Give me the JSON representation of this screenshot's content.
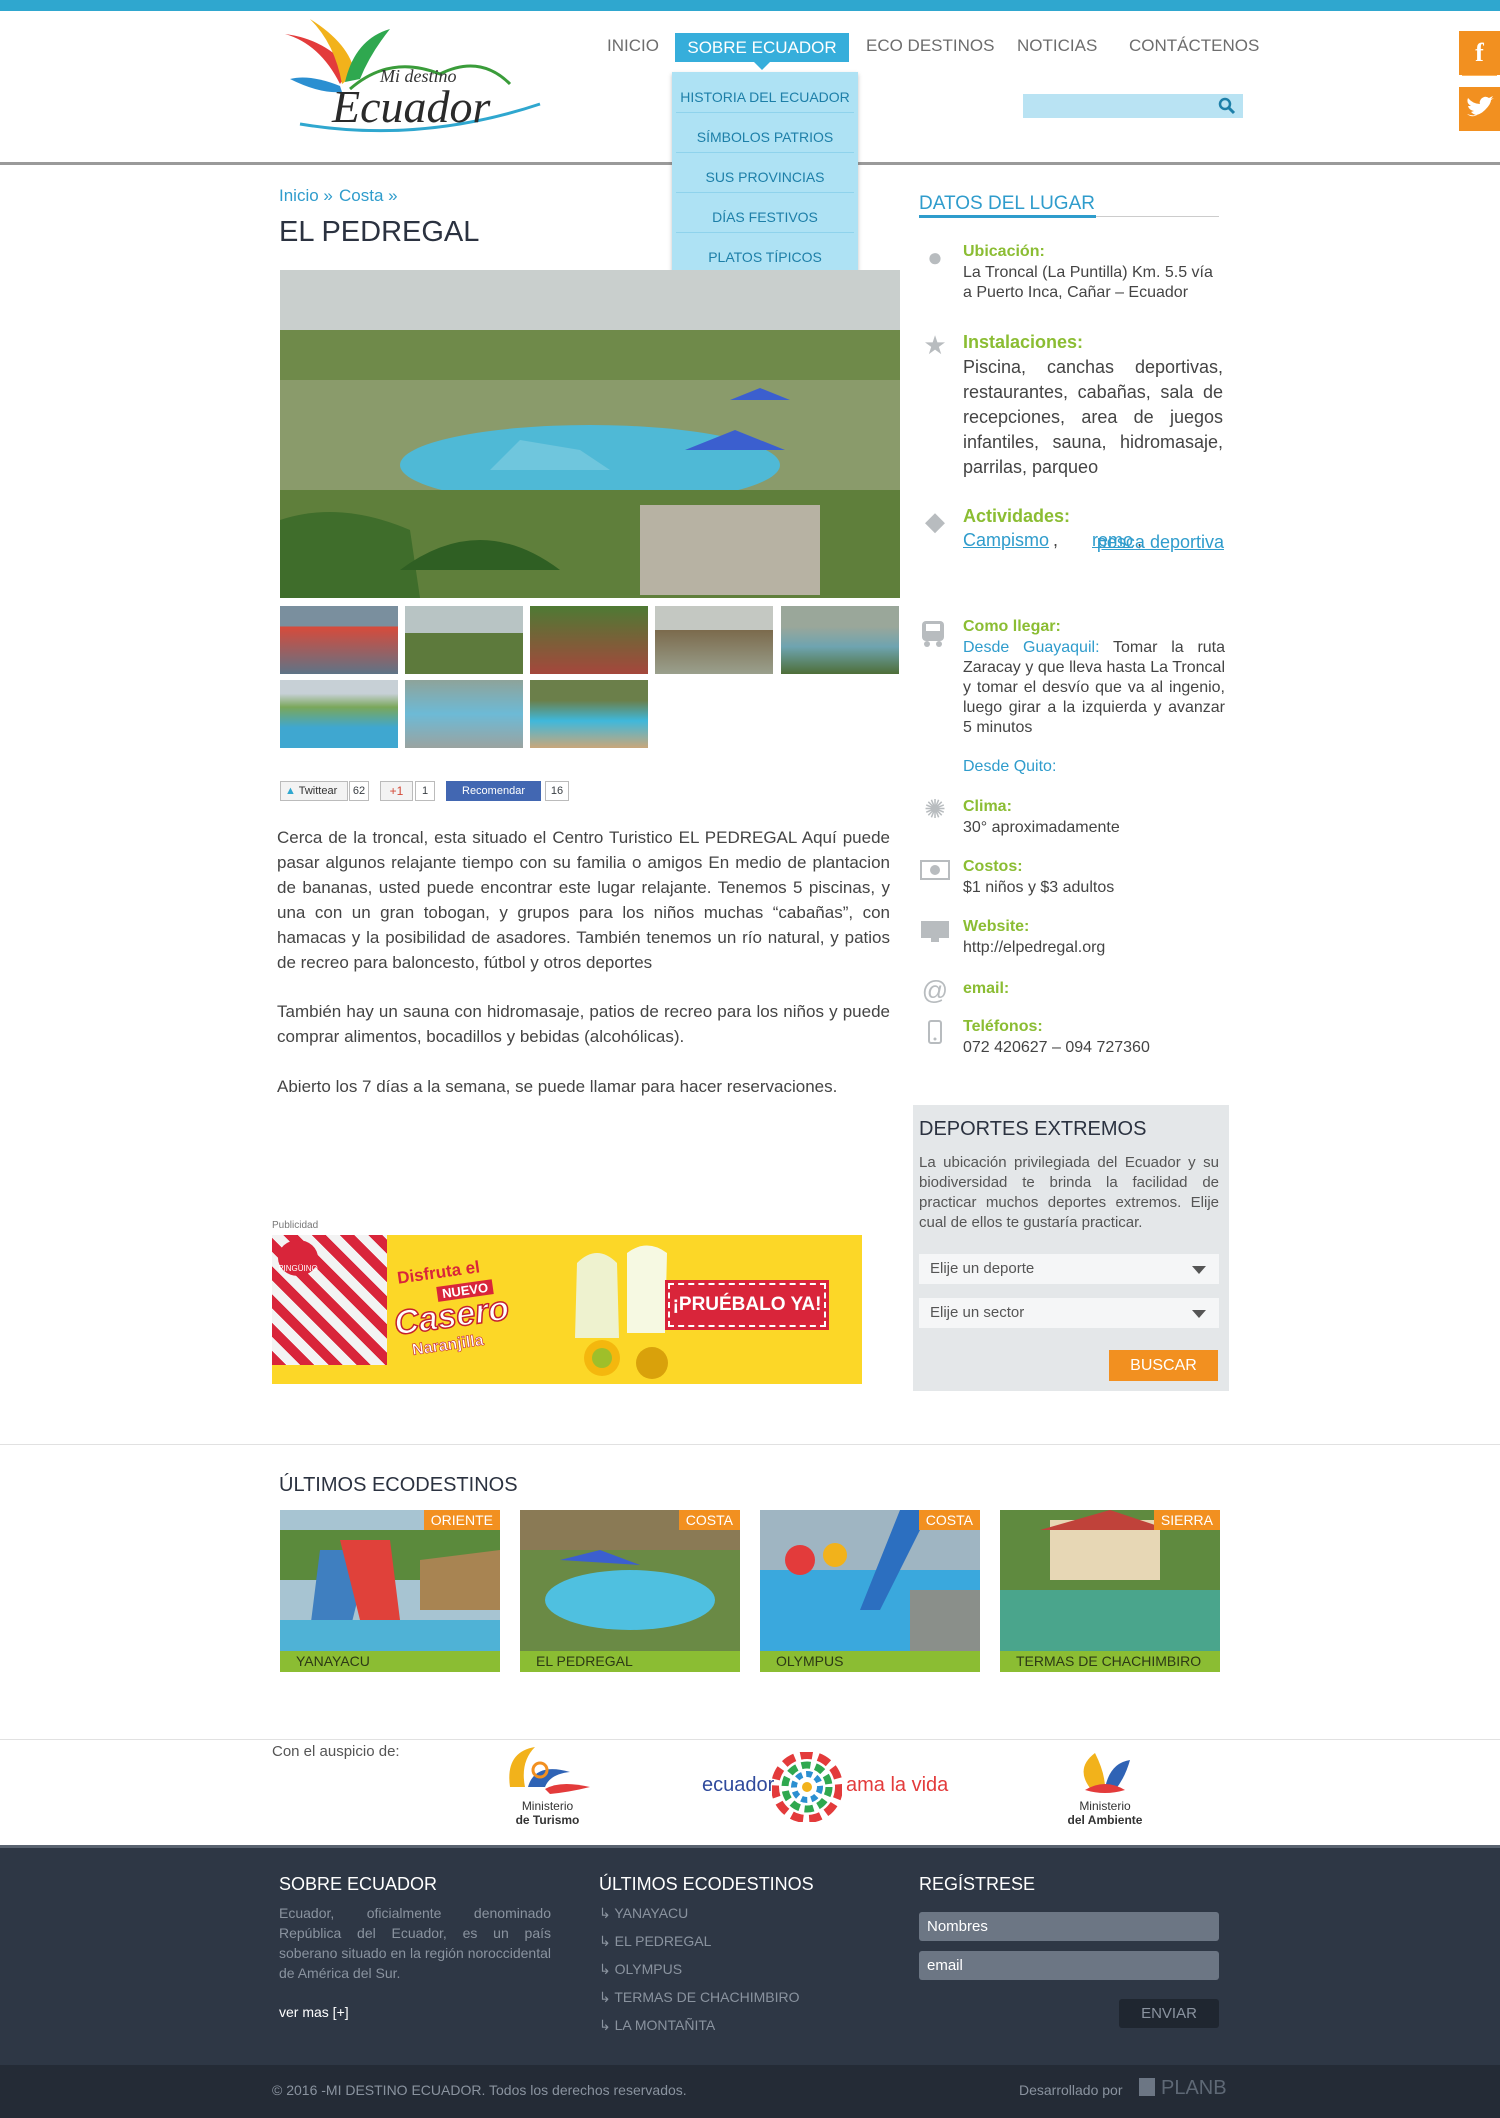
{
  "nav": [
    "INICIO",
    "SOBRE ECUADOR",
    "ECO DESTINOS",
    "NOTICIAS",
    "CONTÁCTENOS"
  ],
  "dropdown": [
    "HISTORIA DEL ECUADOR",
    "SÍMBOLOS PATRIOS",
    "SUS PROVINCIAS",
    "DÍAS FESTIVOS",
    "PLATOS TÍPICOS"
  ],
  "breadcrumb": {
    "home": "Inicio »",
    "section": "Costa »"
  },
  "title": "EL PEDREGAL",
  "share": {
    "tw": "Twittear",
    "tw_count": "62",
    "gp": "+1",
    "gp_count": "1",
    "fb": "Recomendar",
    "fb_count": "16"
  },
  "article_p1": "Cerca de la troncal, esta situado el Centro Turistico EL PEDREGAL Aquí puede pasar algunos relajante tiempo con su familia o amigos En medio de plantacion de bananas, usted puede encontrar este lugar relajante. Tenemos 5 piscinas, y una con un gran tobogan, y grupos para los niños muchas “cabañas”, con hamacas y la posibilidad de asadores. También tenemos un río natural, y  patios de recreo para baloncesto, fútbol y otros deportes",
  "article_p2": "También hay un sauna con hidromasaje, patios de recreo para los niños y puede comprar alimentos, bocadillos y bebidas (alcohólicas).",
  "article_p3": "Abierto los 7 días a la semana, se puede llamar para hacer reservaciones.",
  "ad": {
    "label": "Publicidad",
    "brand": "PINGÜINO",
    "h1": "Disfruta el",
    "h2": "NUEVO",
    "h3": "Casero",
    "h4": "Naranjilla",
    "cta": "¡PRUÉBALO YA!"
  },
  "datos_title": "DATOS DEL LUGAR",
  "ubicacion": {
    "label": "Ubicación:",
    "value": "La Troncal (La Puntilla) Km. 5.5 vía a Puerto Inca, Cañar – Ecuador"
  },
  "instalaciones": {
    "label": "Instalaciones:",
    "value": "Piscina, canchas deportivas, restaurantes, cabañas, sala de recepciones, area de juegos infantiles, sauna, hidromasaje, parrilas, parqueo"
  },
  "actividades": {
    "label": "Actividades:",
    "a1": "Campismo",
    "a2": "remo",
    "a3": "pesca deportiva"
  },
  "llegar": {
    "label": "Como llegar:",
    "gye": "Desde Guayaquil:",
    "gye_text": "Tomar la ruta Zaracay y que lleva hasta La Troncal y tomar el desvío que va al ingenio, luego girar a la izquierda y avanzar 5 minutos",
    "uio": "Desde Quito:"
  },
  "clima": {
    "label": "Clima:",
    "value": "30° aproximadamente"
  },
  "costos": {
    "label": "Costos:",
    "value": "$1 niños y $3 adultos"
  },
  "web": {
    "label": "Website:",
    "value": "http://elpedregal.org"
  },
  "email_label": "email:",
  "tel": {
    "label": "Teléfonos:",
    "value": "072 420627 – 094 727360"
  },
  "deportes": {
    "title": "DEPORTES EXTREMOS",
    "text": "La ubicación privilegiada del Ecuador y su biodiversidad te brinda la facilidad de practicar muchos deportes extremos. Elije cual de ellos te gustaría practicar.",
    "sel1": "Elije un deporte",
    "sel2": "Elije un sector",
    "btn": "BUSCAR"
  },
  "ultimos_title": "ÚLTIMOS ECODESTINOS",
  "cards": [
    {
      "tag": "ORIENTE",
      "name": "YANAYACU"
    },
    {
      "tag": "COSTA",
      "name": "EL PEDREGAL"
    },
    {
      "tag": "COSTA",
      "name": "OLYMPUS"
    },
    {
      "tag": "SIERRA",
      "name": "TERMAS DE CHACHIMBIRO"
    }
  ],
  "sponsors": {
    "label": "Con el auspicio de:",
    "mintur1": "Ministerio",
    "mintur2": "de Turismo",
    "ecu1": "ecuador",
    "ecu2": "ama la vida",
    "minamb1": "Ministerio",
    "minamb2": "del Ambiente"
  },
  "footer": {
    "sobre_title": "SOBRE ECUADOR",
    "sobre_text": "Ecuador, oficialmente denominado República del Ecuador, es un país soberano situado en la región noroccidental de América del Sur.",
    "ver_mas": "ver mas  [+]",
    "ult_title": "ÚLTIMOS ECODESTINOS",
    "ult": [
      "YANAYACU",
      "EL PEDREGAL",
      "OLYMPUS",
      "TERMAS DE CHACHIMBIRO",
      "LA MONTAÑITA"
    ],
    "reg_title": "REGÍSTRESE",
    "nombres": "Nombres",
    "email_ph": "email",
    "enviar": "ENVIAR",
    "copy": "© 2016 -MI DESTINO ECUADOR. Todos los derechos reservados.",
    "dev": "Desarrollado por",
    "dev_brand": "PLANB"
  }
}
